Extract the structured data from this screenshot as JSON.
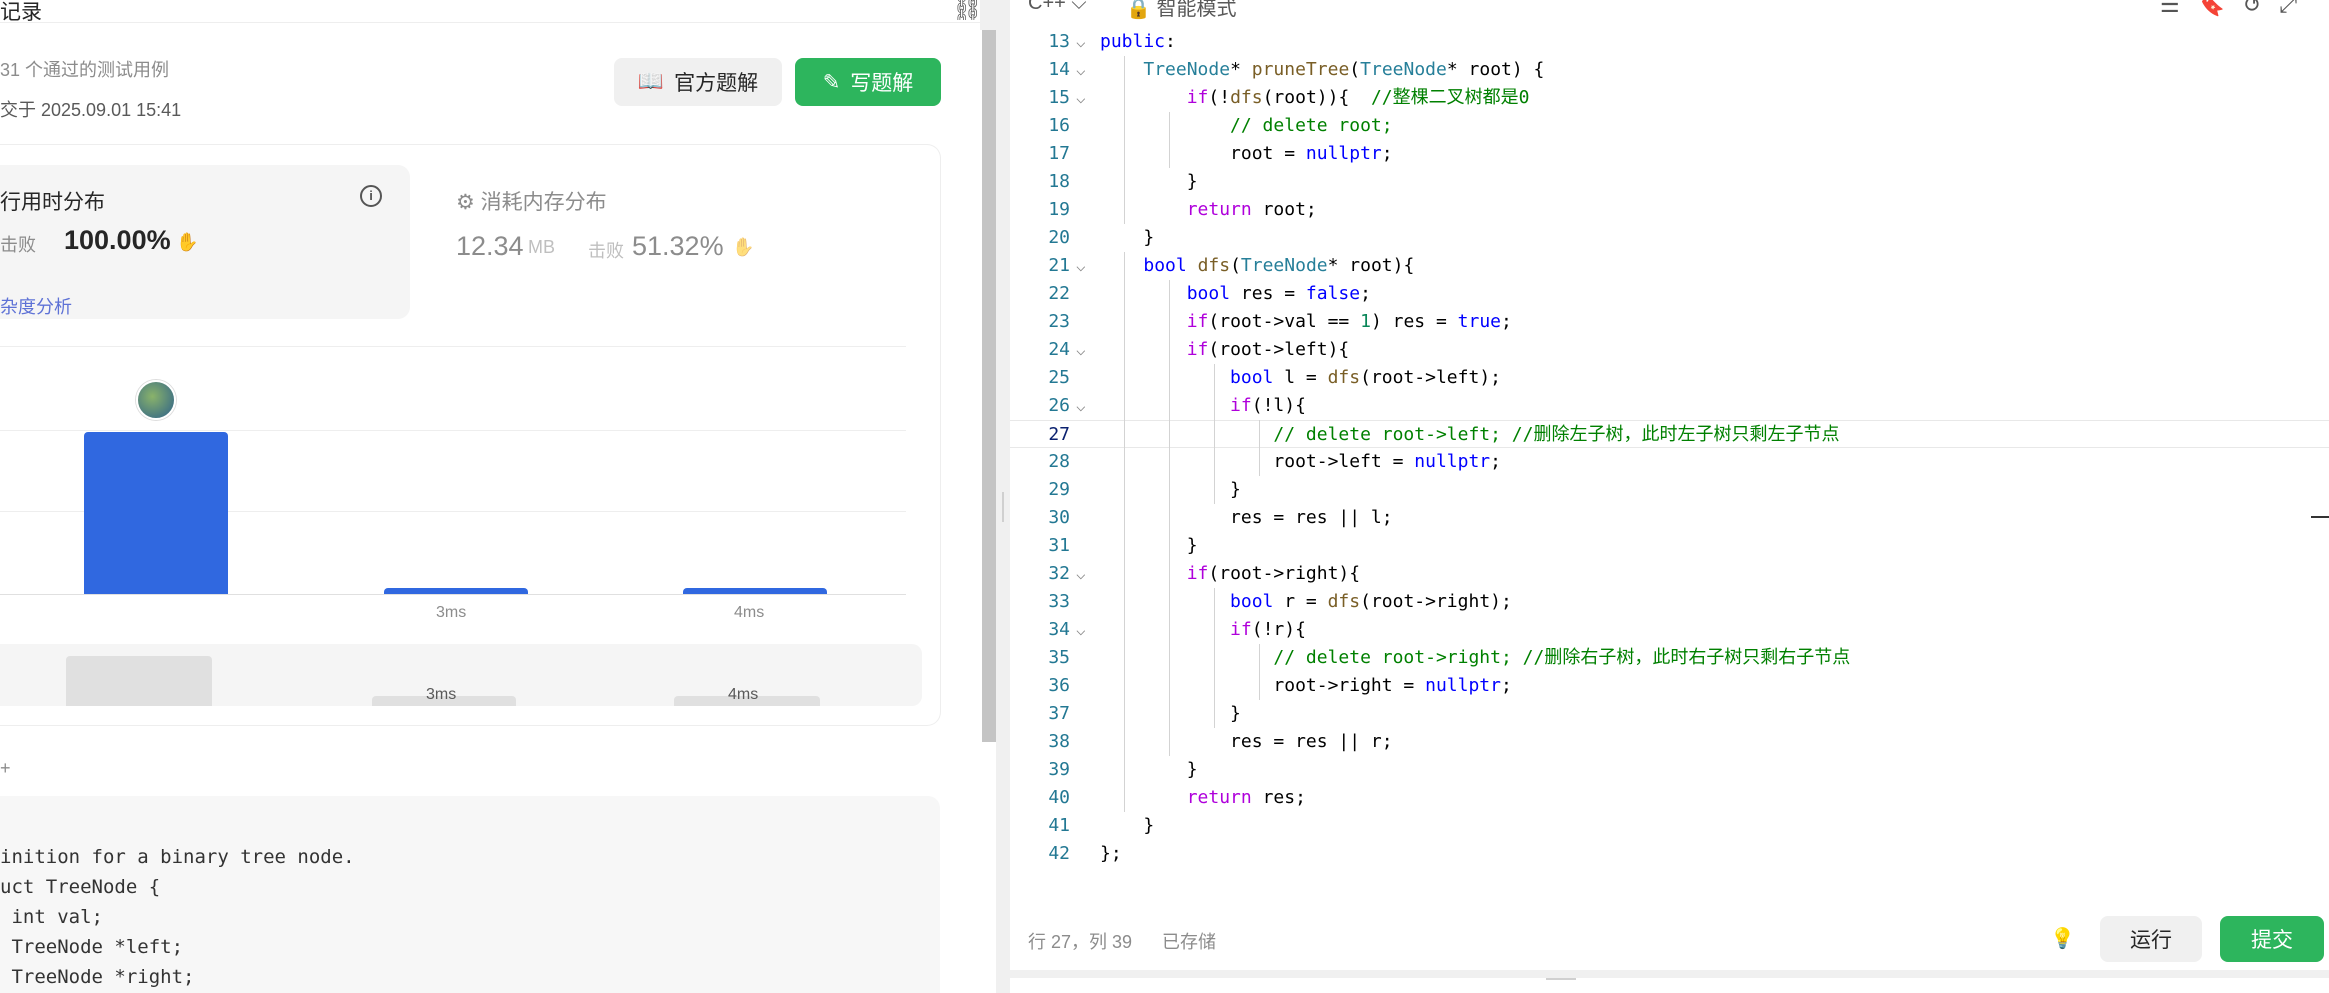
{
  "left": {
    "header_title": "记录",
    "passed_text": "31 个通过的测试用例",
    "submitted_text": "交于 2025.09.01 15:41",
    "btn_official": "官方题解",
    "btn_write": "写题解",
    "runtime": {
      "title": "行用时分布",
      "beat_label": "击败",
      "beat_pct": "100.00%",
      "complexity_link": "杂度分析"
    },
    "memory": {
      "title": "消耗内存分布",
      "value": "12.34",
      "unit": "MB",
      "beat_label": "击败",
      "beat_pct": "51.32%"
    },
    "chart": {
      "xticks": [
        "3ms",
        "4ms"
      ],
      "mini_ticks": [
        "3ms",
        "4ms"
      ]
    },
    "plus_text": "+",
    "code_preview": [
      "inition for a binary tree node.",
      "uct TreeNode {",
      " int val;",
      " TreeNode *left;",
      " TreeNode *right;"
    ]
  },
  "chart_data": {
    "type": "bar",
    "categories": [
      "",
      "3ms",
      "4ms"
    ],
    "values": [
      100,
      3,
      3
    ],
    "title": "",
    "xlabel": "",
    "ylabel": ""
  },
  "editor": {
    "language": "C++",
    "mode": "智能模式",
    "lines": [
      {
        "n": "13",
        "fold": "⌵",
        "html": "<span class=\"kw2\">public</span>:"
      },
      {
        "n": "14",
        "fold": "⌵",
        "html": "    <span class=\"ty\">TreeNode</span>* <span class=\"fn\">pruneTree</span>(<span class=\"ty\">TreeNode</span>* root) {"
      },
      {
        "n": "15",
        "fold": "⌵",
        "html": "        <span class=\"kw\">if</span>(!<span class=\"fn\">dfs</span>(root)){  <span class=\"cm\">//整棵二叉树都是0</span>"
      },
      {
        "n": "16",
        "fold": "",
        "html": "            <span class=\"cm\">// delete root;</span>"
      },
      {
        "n": "17",
        "fold": "",
        "html": "            root = <span class=\"kw2\">nullptr</span>;"
      },
      {
        "n": "18",
        "fold": "",
        "html": "        }"
      },
      {
        "n": "19",
        "fold": "",
        "html": "        <span class=\"kw\">return</span> root;"
      },
      {
        "n": "20",
        "fold": "",
        "html": "    }"
      },
      {
        "n": "21",
        "fold": "⌵",
        "html": "    <span class=\"kw2\">bool</span> <span class=\"fn\">dfs</span>(<span class=\"ty\">TreeNode</span>* root){"
      },
      {
        "n": "22",
        "fold": "",
        "html": "        <span class=\"kw2\">bool</span> res = <span class=\"kw2\">false</span>;"
      },
      {
        "n": "23",
        "fold": "",
        "html": "        <span class=\"kw\">if</span>(root-&gt;val == <span class=\"nm\">1</span>) res = <span class=\"kw2\">true</span>;"
      },
      {
        "n": "24",
        "fold": "⌵",
        "html": "        <span class=\"kw\">if</span>(root-&gt;left){"
      },
      {
        "n": "25",
        "fold": "",
        "html": "            <span class=\"kw2\">bool</span> l = <span class=\"fn\">dfs</span>(root-&gt;left);"
      },
      {
        "n": "26",
        "fold": "⌵",
        "html": "            <span class=\"kw\">if</span>(!l){"
      },
      {
        "n": "27",
        "fold": "",
        "html": "                <span class=\"cm\">// delete root-&gt;left; //删除左子树，此时左子树只剩左子节点</span>",
        "current": true
      },
      {
        "n": "28",
        "fold": "",
        "html": "                root-&gt;left = <span class=\"kw2\">nullptr</span>;"
      },
      {
        "n": "29",
        "fold": "",
        "html": "            }"
      },
      {
        "n": "30",
        "fold": "",
        "html": "            res = res || l;"
      },
      {
        "n": "31",
        "fold": "",
        "html": "        }"
      },
      {
        "n": "32",
        "fold": "⌵",
        "html": "        <span class=\"kw\">if</span>(root-&gt;right){"
      },
      {
        "n": "33",
        "fold": "",
        "html": "            <span class=\"kw2\">bool</span> r = <span class=\"fn\">dfs</span>(root-&gt;right);"
      },
      {
        "n": "34",
        "fold": "⌵",
        "html": "            <span class=\"kw\">if</span>(!r){"
      },
      {
        "n": "35",
        "fold": "",
        "html": "                <span class=\"cm\">// delete root-&gt;right; //删除右子树，此时右子树只剩右子节点</span>"
      },
      {
        "n": "36",
        "fold": "",
        "html": "                root-&gt;right = <span class=\"kw2\">nullptr</span>;"
      },
      {
        "n": "37",
        "fold": "",
        "html": "            }"
      },
      {
        "n": "38",
        "fold": "",
        "html": "            res = res || r;"
      },
      {
        "n": "39",
        "fold": "",
        "html": "        }"
      },
      {
        "n": "40",
        "fold": "",
        "html": "        <span class=\"kw\">return</span> res;"
      },
      {
        "n": "41",
        "fold": "",
        "html": "    }"
      },
      {
        "n": "42",
        "fold": "",
        "html": "};"
      }
    ],
    "status_pos": "行 27，列 39",
    "status_saved": "已存储",
    "run_label": "运行",
    "submit_label": "提交"
  }
}
